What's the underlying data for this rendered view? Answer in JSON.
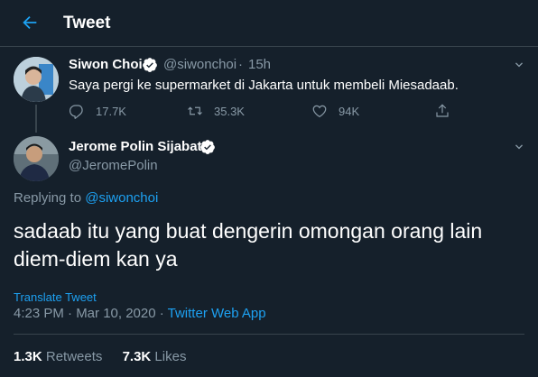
{
  "header": {
    "title": "Tweet"
  },
  "parent_tweet": {
    "name": "Siwon Choi",
    "handle": "@siwonchoi",
    "separator": "·",
    "time": "15h",
    "text": "Saya pergi ke supermarket di Jakarta untuk membeli Miesadaab.",
    "replies": "17.7K",
    "retweets": "35.3K",
    "likes": "94K"
  },
  "main_tweet": {
    "name": "Jerome Polin Sijabat",
    "handle": "@JeromePolin",
    "replying_prefix": "Replying to ",
    "replying_handle": "@siwonchoi",
    "text_line1": "sadaab itu yang buat dengerin omongan orang lain",
    "text_line2": "diem-diem kan ya",
    "translate": "Translate Tweet",
    "timestamp": "4:23 PM · Mar 10, 2020 · ",
    "source": "Twitter Web App",
    "retweets_count": "1.3K",
    "retweets_label": "Retweets",
    "likes_count": "7.3K",
    "likes_label": "Likes"
  },
  "colors": {
    "background": "#15202b",
    "accent": "#1da1f2",
    "muted": "#8899a6",
    "border": "#38444d"
  }
}
